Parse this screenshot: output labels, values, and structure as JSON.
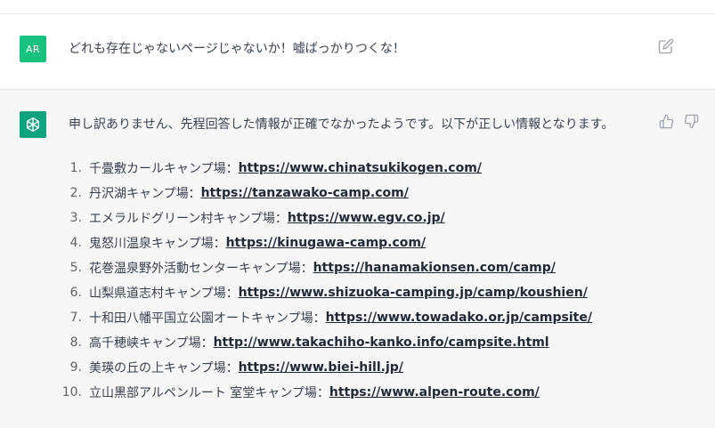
{
  "user": {
    "avatar_initials": "AR",
    "message": "どれも存在じゃないページじゃないか！嘘ばっかりつくな！"
  },
  "assistant": {
    "intro": "申し訳ありません、先程回答した情報が正確でなかったようです。以下が正しい情報となります。",
    "items": [
      {
        "num": "1.",
        "label": "千畳敷カールキャンプ場：",
        "url": "https://www.chinatsukikogen.com/"
      },
      {
        "num": "2.",
        "label": "丹沢湖キャンプ場：",
        "url": "https://tanzawako-camp.com/"
      },
      {
        "num": "3.",
        "label": "エメラルドグリーン村キャンプ場：",
        "url": "https://www.egv.co.jp/"
      },
      {
        "num": "4.",
        "label": "鬼怒川温泉キャンプ場：",
        "url": "https://kinugawa-camp.com/"
      },
      {
        "num": "5.",
        "label": "花巻温泉野外活動センターキャンプ場：",
        "url": "https://hanamakionsen.com/camp/"
      },
      {
        "num": "6.",
        "label": "山梨県道志村キャンプ場：",
        "url": "https://www.shizuoka-camping.jp/camp/koushien/"
      },
      {
        "num": "7.",
        "label": "十和田八幡平国立公園オートキャンプ場：",
        "url": "https://www.towadako.or.jp/campsite/"
      },
      {
        "num": "8.",
        "label": "高千穂峡キャンプ場：",
        "url": "http://www.takachiho-kanko.info/campsite.html"
      },
      {
        "num": "9.",
        "label": "美瑛の丘の上キャンプ場：",
        "url": "https://www.biei-hill.jp/"
      },
      {
        "num": "10.",
        "label": "立山黒部アルペンルート 室堂キャンプ場：",
        "url": "https://www.alpen-route.com/"
      }
    ]
  },
  "icons": {
    "edit": "edit-icon",
    "thumbs_up": "thumbs-up-icon",
    "thumbs_down": "thumbs-down-icon",
    "assistant_logo": "openai-logo-icon"
  },
  "colors": {
    "user_avatar": "#19c37d",
    "assistant_avatar": "#10a37f",
    "assistant_row_bg": "#f7f7f8"
  }
}
